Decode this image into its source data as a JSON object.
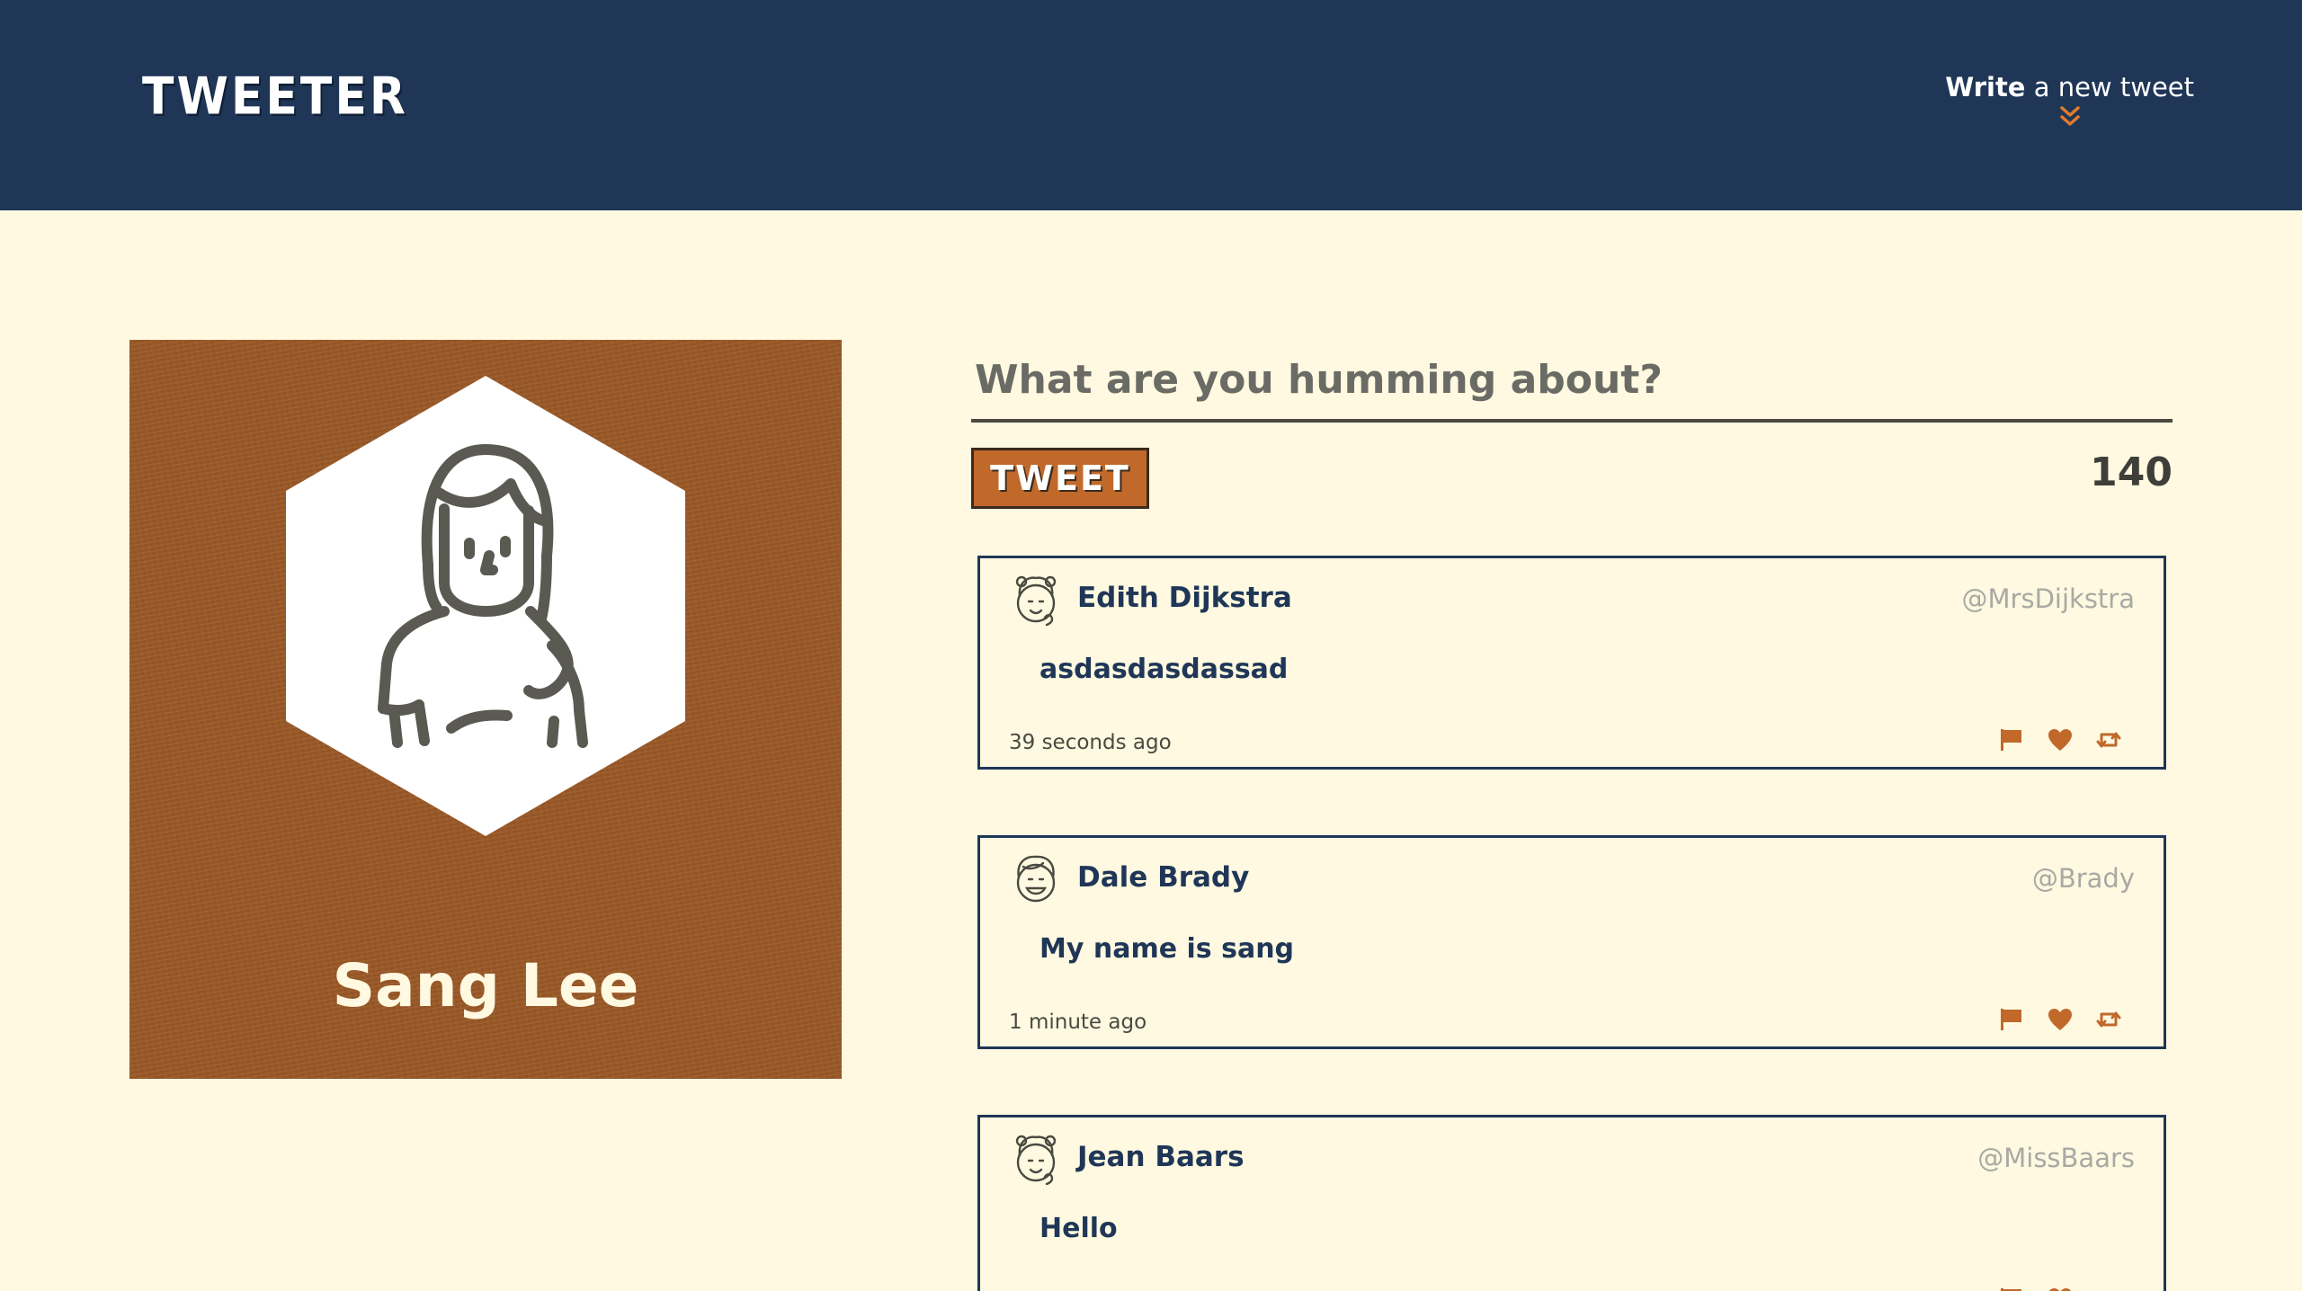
{
  "header": {
    "logo": "TWEETER",
    "compose_toggle": {
      "bold": "Write",
      "rest": " a new tweet"
    }
  },
  "profile": {
    "name": "Sang Lee"
  },
  "compose": {
    "placeholder": "What are you humming about?",
    "button_label": "TWEET",
    "counter": "140"
  },
  "tweets": [
    {
      "name": "Edith Dijkstra",
      "handle": "@MrsDijkstra",
      "body": "asdasdasdassad",
      "time": "39 seconds ago"
    },
    {
      "name": "Dale Brady",
      "handle": "@Brady",
      "body": "My name is sang",
      "time": "1 minute ago"
    },
    {
      "name": "Jean Baars",
      "handle": "@MissBaars",
      "body": "Hello",
      "time": ""
    }
  ],
  "colors": {
    "navy": "#1f3657",
    "cream": "#fef9e0",
    "accent": "#c0692b",
    "card_brown": "#9c5a28"
  }
}
